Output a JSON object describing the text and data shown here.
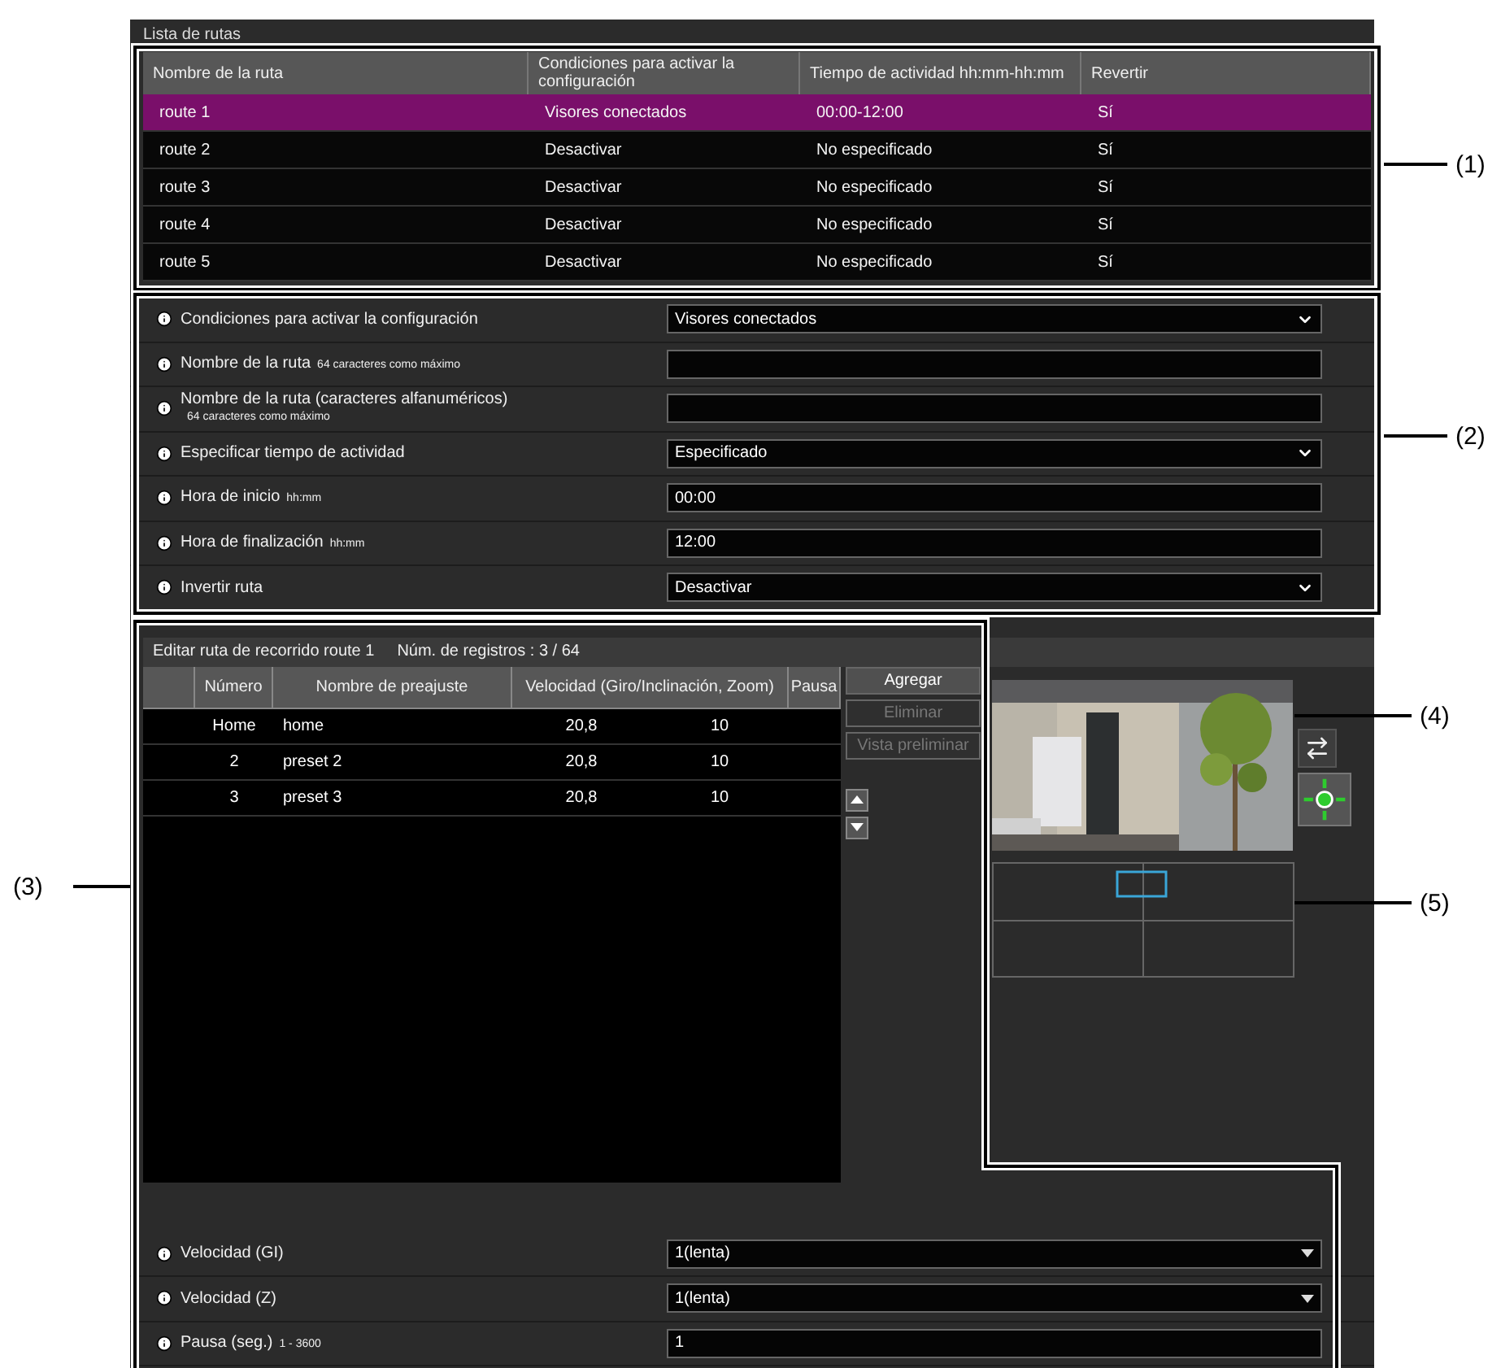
{
  "title": "Lista de rutas",
  "route_table": {
    "columns": [
      "Nombre de la ruta",
      "Condiciones para activar la configuración",
      "Tiempo de actividad hh:mm-hh:mm",
      "Revertir"
    ],
    "rows": [
      {
        "cells": [
          "route  1",
          "Visores conectados",
          "00:00-12:00",
          "Sí"
        ],
        "selected": true
      },
      {
        "cells": [
          "route  2",
          "Desactivar",
          "No especificado",
          "Sí"
        ],
        "selected": false
      },
      {
        "cells": [
          "route  3",
          "Desactivar",
          "No especificado",
          "Sí"
        ],
        "selected": false
      },
      {
        "cells": [
          "route  4",
          "Desactivar",
          "No especificado",
          "Sí"
        ],
        "selected": false
      },
      {
        "cells": [
          "route  5",
          "Desactivar",
          "No especificado",
          "Sí"
        ],
        "selected": false
      }
    ]
  },
  "route_form": [
    {
      "label": "Condiciones para activar la configuración",
      "kind": "select",
      "value": "Visores conectados"
    },
    {
      "label": "Nombre de la ruta",
      "hint": "64 caracteres como máximo",
      "kind": "input"
    },
    {
      "label": "Nombre de la ruta (caracteres alfanuméricos)",
      "hint": "64 caracteres como máximo",
      "kind": "input"
    },
    {
      "label": "Especificar tiempo de actividad",
      "kind": "select",
      "value": "Especificado"
    },
    {
      "label": "Hora de inicio",
      "hint": "hh:mm",
      "kind": "input",
      "value": "00:00"
    },
    {
      "label": "Hora de finalización",
      "hint": "hh:mm",
      "kind": "input",
      "value": "12:00"
    },
    {
      "label": "Invertir ruta",
      "kind": "select",
      "value": "Desactivar"
    }
  ],
  "edit": {
    "title": "Editar ruta de recorrido route  1",
    "count": "Núm. de registros : 3 / 64",
    "columns": [
      "Número",
      "Nombre de preajuste",
      "Velocidad (Giro/Inclinación, Zoom)",
      "Pausa"
    ],
    "rows": [
      {
        "number": "Home",
        "name": "home",
        "speed_pan_tilt": "20,8",
        "speed_zoom": "10"
      },
      {
        "number": "2",
        "name": "preset  2",
        "speed_pan_tilt": "20,8",
        "speed_zoom": "10"
      },
      {
        "number": "3",
        "name": "preset  3",
        "speed_pan_tilt": "20,8",
        "speed_zoom": "10"
      }
    ],
    "buttons": [
      {
        "label": "Agregar",
        "disabled": false
      },
      {
        "label": "Eliminar",
        "disabled": true
      },
      {
        "label": "Vista preliminar",
        "disabled": true
      }
    ]
  },
  "settings": [
    {
      "label": "Velocidad (GI)",
      "kind": "select",
      "value": "1(lenta)"
    },
    {
      "label": "Velocidad (Z)",
      "kind": "select",
      "value": "1(lenta)"
    },
    {
      "label": "Pausa (seg.)",
      "hint": "1 - 3600",
      "kind": "input",
      "value": "1"
    }
  ],
  "callouts": [
    "(1)",
    "(2)",
    "(3)",
    "(4)",
    "(5)"
  ]
}
